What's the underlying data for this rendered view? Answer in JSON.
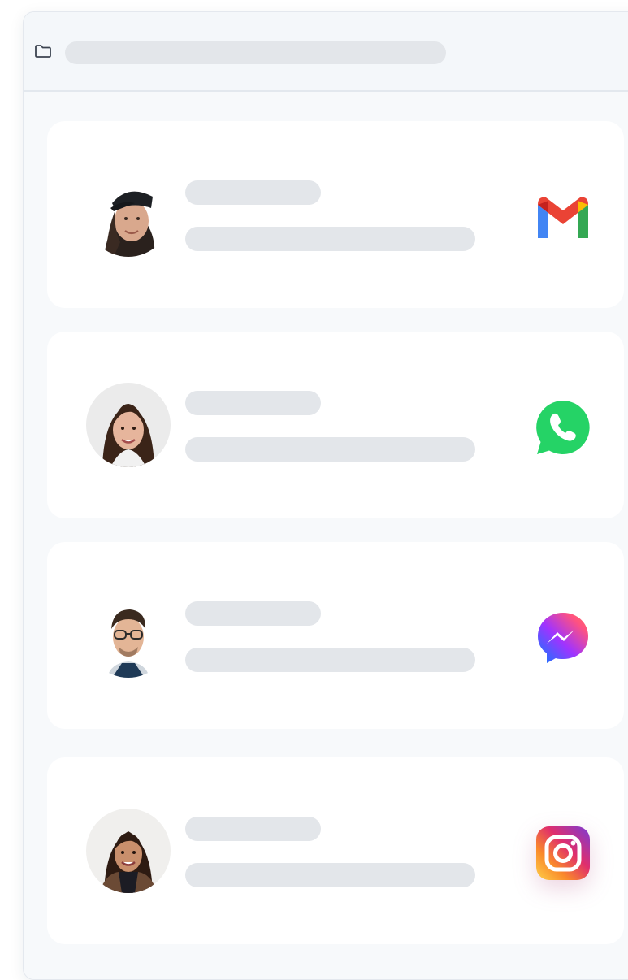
{
  "toolbar": {
    "folder_icon": "folder-icon",
    "path_placeholder": ""
  },
  "conversations": [
    {
      "avatar": "woman-with-cap",
      "app": "gmail-icon",
      "title": "",
      "preview": ""
    },
    {
      "avatar": "woman-long-hair",
      "app": "whatsapp-icon",
      "title": "",
      "preview": "",
      "app_color": "#25D366"
    },
    {
      "avatar": "man-with-glasses",
      "app": "messenger-icon",
      "title": "",
      "preview": ""
    },
    {
      "avatar": "woman-smiling",
      "app": "instagram-icon",
      "title": "",
      "preview": ""
    }
  ],
  "colors": {
    "window_bg": "#f7f9fb",
    "card_bg": "#ffffff",
    "skeleton": "#e3e6ea"
  }
}
